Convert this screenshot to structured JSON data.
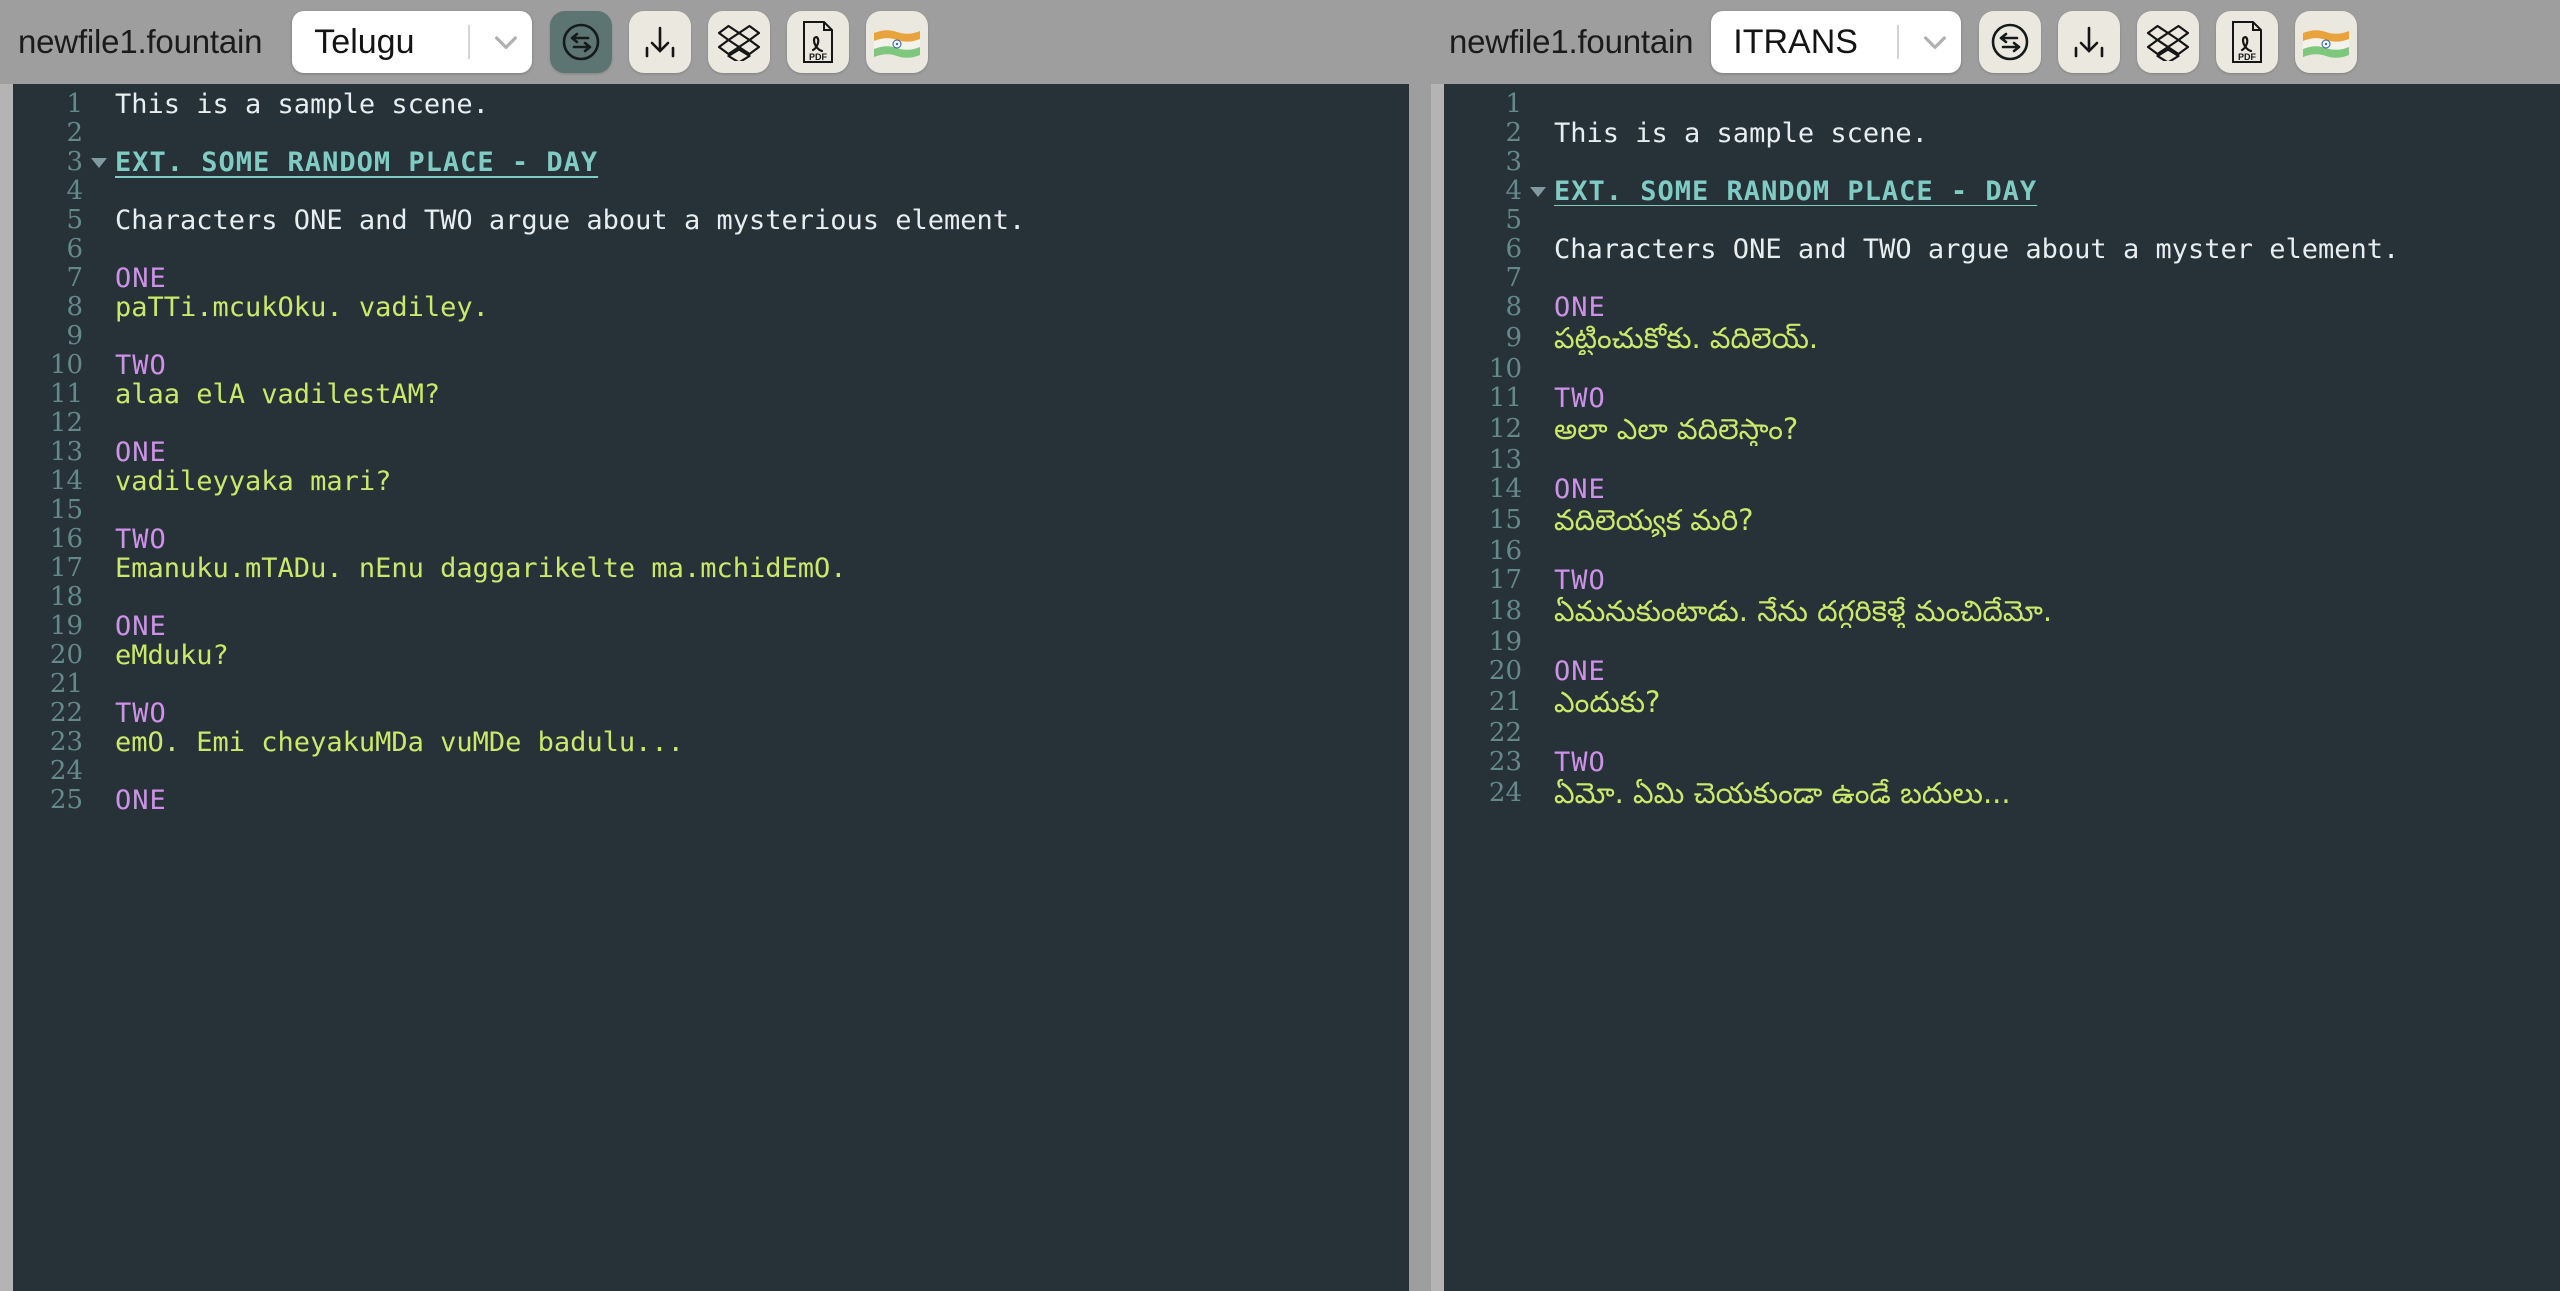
{
  "app": {
    "name": "fountain-screenplay-editor",
    "accent": "#5c7472",
    "toolbar_bg": "#9e9e9e",
    "editor_bg": "#263238"
  },
  "panes": [
    {
      "id": "left",
      "filename": "newfile1.fountain",
      "script_select": {
        "value": "Telugu",
        "chevron": "chevron-down-icon"
      },
      "icons": [
        {
          "name": "transliterate-swap-icon",
          "label": "Transliterate",
          "active": true
        },
        {
          "name": "download-icon",
          "label": "Download",
          "active": false
        },
        {
          "name": "dropbox-icon",
          "label": "Dropbox",
          "active": false
        },
        {
          "name": "pdf-icon",
          "label": "PDF",
          "active": false
        },
        {
          "name": "india-flag-icon",
          "label": "Language",
          "active": false
        }
      ],
      "lines": [
        {
          "n": "1",
          "text": "This is a sample scene.",
          "type": "action",
          "fold": false
        },
        {
          "n": "2",
          "text": "",
          "type": "action",
          "fold": false
        },
        {
          "n": "3",
          "text": "EXT. SOME RANDOM PLACE - DAY",
          "type": "scene",
          "fold": true
        },
        {
          "n": "4",
          "text": "",
          "type": "action",
          "fold": false
        },
        {
          "n": "5",
          "text": "Characters ONE and TWO argue about a mysterious element.",
          "type": "action",
          "fold": false
        },
        {
          "n": "6",
          "text": "",
          "type": "action",
          "fold": false
        },
        {
          "n": "7",
          "text": "ONE",
          "type": "char",
          "fold": false
        },
        {
          "n": "8",
          "text": "paTTi.mcukOku. vadiley.",
          "type": "dialog",
          "fold": false
        },
        {
          "n": "9",
          "text": "",
          "type": "action",
          "fold": false
        },
        {
          "n": "10",
          "text": "TWO",
          "type": "char",
          "fold": false
        },
        {
          "n": "11",
          "text": "alaa elA vadilestAM?",
          "type": "dialog",
          "fold": false
        },
        {
          "n": "12",
          "text": "",
          "type": "action",
          "fold": false
        },
        {
          "n": "13",
          "text": "ONE",
          "type": "char",
          "fold": false
        },
        {
          "n": "14",
          "text": "vadileyyaka mari?",
          "type": "dialog",
          "fold": false
        },
        {
          "n": "15",
          "text": "",
          "type": "action",
          "fold": false
        },
        {
          "n": "16",
          "text": "TWO",
          "type": "char",
          "fold": false
        },
        {
          "n": "17",
          "text": "Emanuku.mTADu. nEnu daggarikelte ma.mchidEmO.",
          "type": "dialog",
          "fold": false
        },
        {
          "n": "18",
          "text": "",
          "type": "action",
          "fold": false
        },
        {
          "n": "19",
          "text": "ONE",
          "type": "char",
          "fold": false
        },
        {
          "n": "20",
          "text": "eMduku?",
          "type": "dialog",
          "fold": false
        },
        {
          "n": "21",
          "text": "",
          "type": "action",
          "fold": false
        },
        {
          "n": "22",
          "text": "TWO",
          "type": "char",
          "fold": false
        },
        {
          "n": "23",
          "text": "emO. Emi cheyakuMDa vuMDe badulu...",
          "type": "dialog",
          "fold": false
        },
        {
          "n": "24",
          "text": "",
          "type": "action",
          "fold": false
        },
        {
          "n": "25",
          "text": "ONE",
          "type": "char",
          "fold": false
        }
      ]
    },
    {
      "id": "right",
      "filename": "newfile1.fountain",
      "script_select": {
        "value": "ITRANS",
        "chevron": "chevron-down-icon"
      },
      "icons": [
        {
          "name": "transliterate-swap-icon",
          "label": "Transliterate",
          "active": false
        },
        {
          "name": "download-icon",
          "label": "Download",
          "active": false
        },
        {
          "name": "dropbox-icon",
          "label": "Dropbox",
          "active": false
        },
        {
          "name": "pdf-icon",
          "label": "PDF",
          "active": false
        },
        {
          "name": "india-flag-icon",
          "label": "Language",
          "active": false
        }
      ],
      "lines": [
        {
          "n": "1",
          "text": "",
          "type": "action",
          "fold": false
        },
        {
          "n": "2",
          "text": "This is a sample scene.",
          "type": "action",
          "fold": false
        },
        {
          "n": "3",
          "text": "",
          "type": "action",
          "fold": false
        },
        {
          "n": "4",
          "text": "EXT. SOME RANDOM PLACE - DAY",
          "type": "scene",
          "fold": true
        },
        {
          "n": "5",
          "text": "",
          "type": "action",
          "fold": false
        },
        {
          "n": "6",
          "text": "Characters ONE and TWO argue about a myster element.",
          "type": "action",
          "fold": false
        },
        {
          "n": "7",
          "text": "",
          "type": "action",
          "fold": false
        },
        {
          "n": "8",
          "text": "ONE",
          "type": "char",
          "fold": false
        },
        {
          "n": "9",
          "text": "పట్టించుకోకు. వదిలెయ్.",
          "type": "telugu",
          "fold": false
        },
        {
          "n": "10",
          "text": "",
          "type": "action",
          "fold": false
        },
        {
          "n": "11",
          "text": "TWO",
          "type": "char",
          "fold": false
        },
        {
          "n": "12",
          "text": "అలా ఎలా వదిలెస్తాం?",
          "type": "telugu",
          "fold": false
        },
        {
          "n": "13",
          "text": "",
          "type": "action",
          "fold": false
        },
        {
          "n": "14",
          "text": "ONE",
          "type": "char",
          "fold": false
        },
        {
          "n": "15",
          "text": "వదిలెయ్యక మరి?",
          "type": "telugu",
          "fold": false
        },
        {
          "n": "16",
          "text": "",
          "type": "action",
          "fold": false
        },
        {
          "n": "17",
          "text": "TWO",
          "type": "char",
          "fold": false
        },
        {
          "n": "18",
          "text": "ఏమనుకుంటాడు. నేను దగ్గరికెళ్తే మంచిదేమో.",
          "type": "telugu",
          "fold": false
        },
        {
          "n": "19",
          "text": "",
          "type": "action",
          "fold": false
        },
        {
          "n": "20",
          "text": "ONE",
          "type": "char",
          "fold": false
        },
        {
          "n": "21",
          "text": "ఎందుకు?",
          "type": "telugu",
          "fold": false
        },
        {
          "n": "22",
          "text": "",
          "type": "action",
          "fold": false
        },
        {
          "n": "23",
          "text": "TWO",
          "type": "char",
          "fold": false
        },
        {
          "n": "24",
          "text": "ఏమో. ఏమి చెయకుండా ఉండే బదులు...",
          "type": "telugu",
          "fold": false
        }
      ]
    }
  ]
}
